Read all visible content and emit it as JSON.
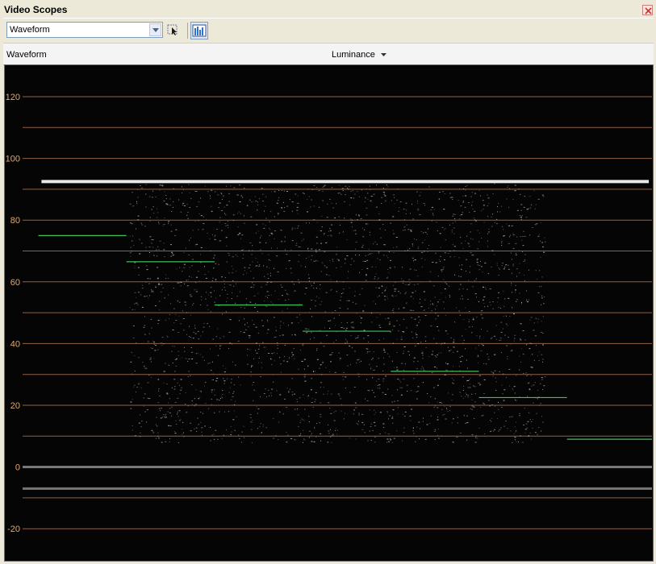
{
  "window": {
    "title": "Video Scopes"
  },
  "toolbar": {
    "scope_select": "Waveform",
    "icons": [
      "dropdown-arrow-icon",
      "pick-cursor-icon",
      "histogram-icon"
    ]
  },
  "header": {
    "scope_name": "Waveform",
    "mode": "Luminance"
  },
  "colors": {
    "graticule": "#c0805c",
    "tick_label": "#e8a864",
    "ramp_step": "#3fbf5a",
    "trace": "#e8e8e8",
    "background": "#050505"
  },
  "chart_data": {
    "type": "scatter",
    "y_ticks": [
      120,
      100,
      80,
      60,
      40,
      20,
      0,
      -20
    ],
    "y_lines": [
      120,
      110,
      100,
      90,
      80,
      70,
      60,
      50,
      40,
      30,
      20,
      10,
      0,
      -10,
      -20
    ],
    "ylim": [
      -27,
      128
    ],
    "grid": true,
    "steps": [
      {
        "x0": 0.025,
        "x1": 0.165,
        "y": 75
      },
      {
        "x0": 0.165,
        "x1": 0.305,
        "y": 66.5
      },
      {
        "x0": 0.305,
        "x1": 0.445,
        "y": 52.5
      },
      {
        "x0": 0.445,
        "x1": 0.585,
        "y": 44
      },
      {
        "x0": 0.585,
        "x1": 0.725,
        "y": 31
      },
      {
        "x0": 0.725,
        "x1": 0.865,
        "y": 22.5
      },
      {
        "x0": 0.865,
        "x1": 1.0,
        "y": 9
      }
    ],
    "top_trace": 92.5,
    "bottom_traces": [
      0,
      -7
    ]
  }
}
